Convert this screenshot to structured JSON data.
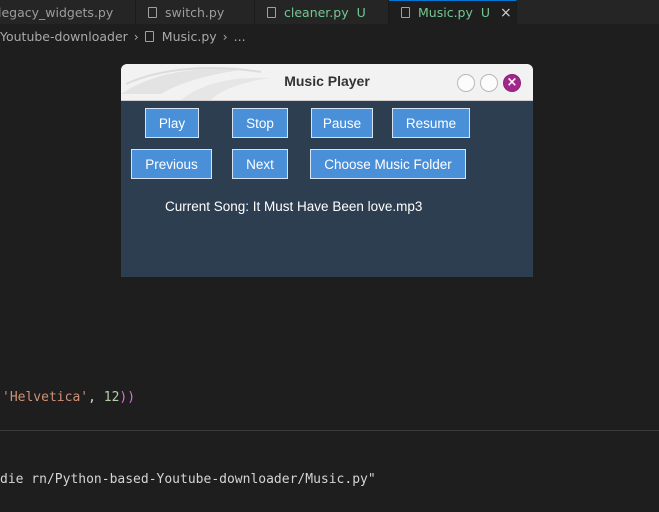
{
  "editor": {
    "tabs": [
      {
        "label": "legacy_widgets.py",
        "status": ""
      },
      {
        "label": "switch.py",
        "status": ""
      },
      {
        "label": "cleaner.py",
        "status": "U"
      },
      {
        "label": "Music.py",
        "status": "U"
      }
    ],
    "active_tab_close": "×",
    "breadcrumb": {
      "folder": "Youtube-downloader",
      "file": "Music.py",
      "more": "..."
    },
    "code_line": {
      "string": "'Helvetica'",
      "comma": ", ",
      "number": "12",
      "close": "))"
    },
    "terminal_text": "die rn/Python-based-Youtube-downloader/Music.py\""
  },
  "player": {
    "title": "Music Player",
    "window_controls": {
      "close_glyph": "×"
    },
    "buttons": {
      "play": "Play",
      "stop": "Stop",
      "pause": "Pause",
      "resume": "Resume",
      "previous": "Previous",
      "next": "Next",
      "choose_folder": "Choose Music Folder"
    },
    "current_song": "Current Song: It Must Have Been love.mp3",
    "colors": {
      "body_bg": "#2d3e50",
      "button_bg": "#4a90d9",
      "titlebar_bg": "#f2f2f2",
      "close_button": "#a3268c"
    }
  }
}
